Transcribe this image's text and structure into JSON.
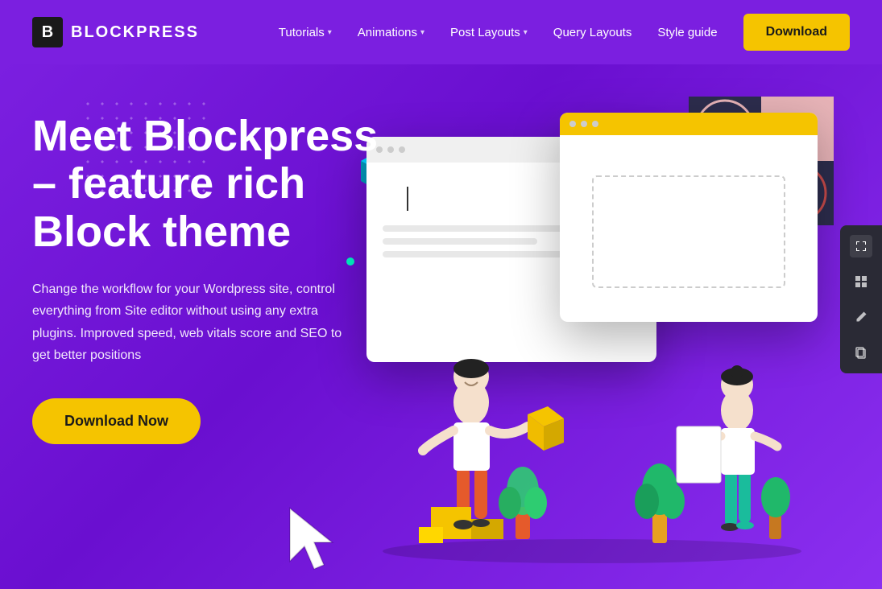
{
  "brand": {
    "logo_icon": "B",
    "logo_text": "LOCKPRESS"
  },
  "navbar": {
    "links": [
      {
        "label": "Tutorials",
        "has_dropdown": true
      },
      {
        "label": "Animations",
        "has_dropdown": true
      },
      {
        "label": "Post Layouts",
        "has_dropdown": true
      },
      {
        "label": "Query Layouts",
        "has_dropdown": false
      },
      {
        "label": "Style guide",
        "has_dropdown": false
      }
    ],
    "download_label": "Download"
  },
  "hero": {
    "title": "Meet Blockpress – feature rich Block theme",
    "description": "Change the workflow for your Wordpress site, control everything from Site editor without using any extra plugins. Improved speed, web vitals score and SEO to get better positions",
    "cta_label": "Download Now"
  },
  "toolbar": {
    "icons": [
      "✛",
      "⊞",
      "✏",
      "⎘"
    ]
  },
  "colors": {
    "bg": "#7B1FE0",
    "cta": "#F5C400",
    "dark": "#1a1a1a"
  }
}
